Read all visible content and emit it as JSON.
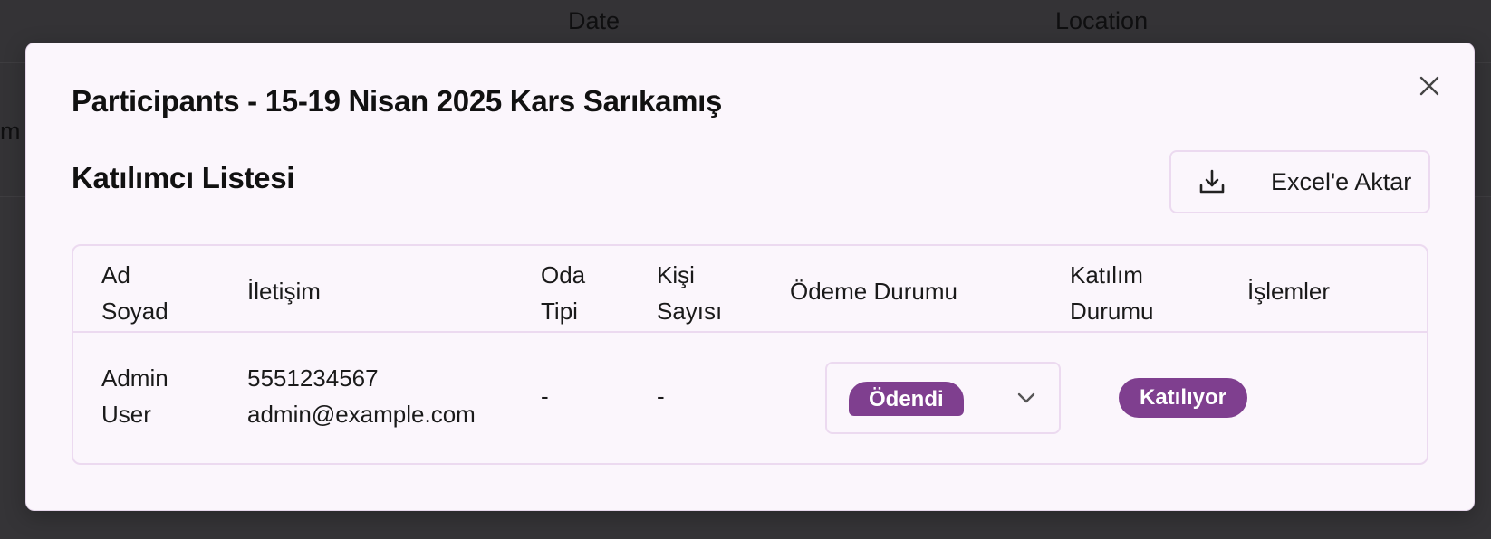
{
  "background": {
    "columns": [
      "Date",
      "Location"
    ],
    "row_fragment": "m"
  },
  "modal": {
    "title": "Participants - 15-19 Nisan 2025 Kars Sarıkamış",
    "close_icon": "close-icon",
    "section_title": "Katılımcı Listesi",
    "export_button": {
      "label": "Excel'e Aktar",
      "icon": "download-icon"
    },
    "table": {
      "headers": [
        [
          "Ad",
          "Soyad"
        ],
        [
          "İletişim"
        ],
        [
          "Oda",
          "Tipi"
        ],
        [
          "Kişi",
          "Sayısı"
        ],
        [
          "Ödeme Durumu"
        ],
        [
          "Katılım",
          "Durumu"
        ],
        [
          "İşlemler"
        ]
      ],
      "rows": [
        {
          "name": [
            "Admin",
            "User"
          ],
          "phone": "5551234567",
          "email": "admin@example.com",
          "room_type": "-",
          "person_count": "-",
          "payment_status": "Ödendi",
          "attendance_status": "Katılıyor"
        }
      ]
    }
  },
  "colors": {
    "accent": "#7f3f8f",
    "modal_bg": "#fbf6fc",
    "border": "#ecdaf0",
    "overlay": "#353437"
  }
}
